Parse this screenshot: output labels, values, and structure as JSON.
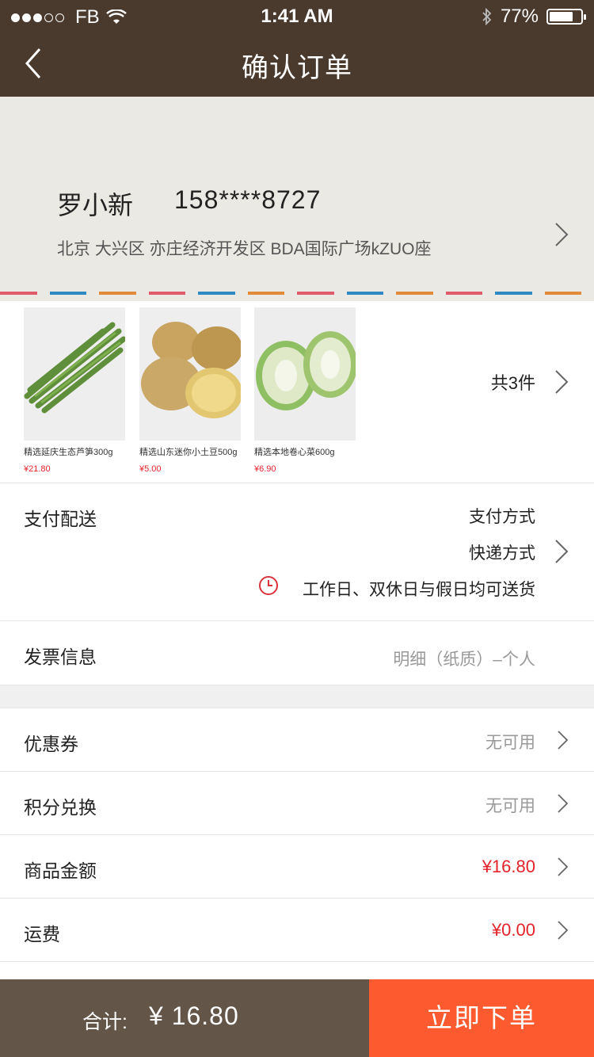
{
  "status_bar": {
    "carrier": "FB",
    "time": "1:41 AM",
    "battery": "77%",
    "battery_level": 0.77
  },
  "nav": {
    "title": "确认订单"
  },
  "address": {
    "name": "罗小新",
    "phone": "158****8727",
    "line": "北京 大兴区 亦庄经济开发区 BDA国际广场kZUO座",
    "stripe_colors": [
      "#e05a6b",
      "#2f8ac4",
      "#e08a3a",
      "#e05a6b",
      "#2f8ac4",
      "#e08a3a",
      "#e05a6b",
      "#2f8ac4",
      "#e08a3a",
      "#e05a6b",
      "#2f8ac4",
      "#e08a3a"
    ]
  },
  "products": {
    "items": [
      {
        "name": "精选延庆生态芦笋300g",
        "price": "¥21.80",
        "icon": "asparagus-image"
      },
      {
        "name": "精选山东迷你小土豆500g",
        "price": "¥5.00",
        "icon": "potato-image"
      },
      {
        "name": "精选本地卷心菜600g",
        "price": "¥6.90",
        "icon": "cabbage-image"
      }
    ],
    "count": "共3件"
  },
  "payment": {
    "label": "支付配送",
    "method": "支付方式",
    "delivery": "快递方式",
    "schedule": "工作日、双休日与假日均可送货"
  },
  "invoice": {
    "label": "发票信息",
    "value": "明细（纸质）–个人"
  },
  "rows": {
    "coupon": {
      "label": "优惠券",
      "value": "无可用"
    },
    "points": {
      "label": "积分兑换",
      "value": "无可用"
    },
    "goods": {
      "label": "商品金额",
      "value": "¥16.80"
    },
    "shipping": {
      "label": "运费",
      "value": "¥0.00"
    }
  },
  "bottom": {
    "total_label": "合计:",
    "total_value": "¥ 16.80",
    "submit_label": "立即下单"
  },
  "colors": {
    "nav_bg": "#4a3a2d",
    "accent_orange": "#fe5a30",
    "price_red": "#e4222a",
    "total_bg": "#635649"
  }
}
